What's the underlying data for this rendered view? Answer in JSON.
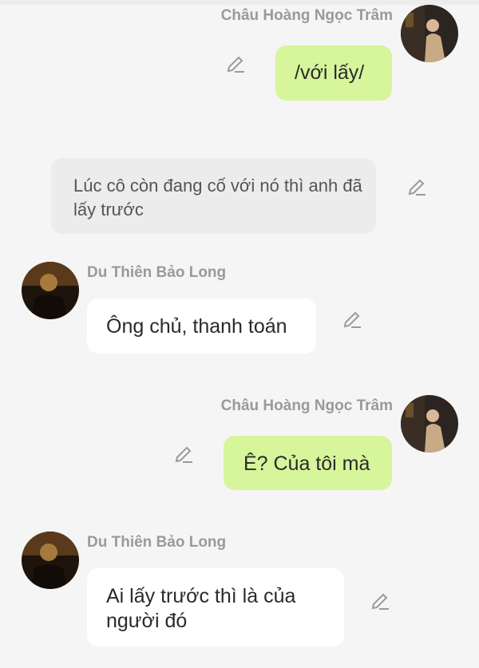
{
  "messages": [
    {
      "sender": "Châu Hoàng Ngọc Trâm",
      "text": "/với lấy/",
      "side": "right",
      "style": "green"
    },
    {
      "text": "Lúc cô còn đang cố với nó thì anh đã lấy trước",
      "style": "narration"
    },
    {
      "sender": "Du Thiên Bảo Long",
      "text": "Ông chủ, thanh toán",
      "side": "left",
      "style": "white"
    },
    {
      "sender": "Châu Hoàng Ngọc Trâm",
      "text": "Ê? Của tôi mà",
      "side": "right",
      "style": "green"
    },
    {
      "sender": "Du Thiên Bảo Long",
      "text": "Ai lấy trước thì là của người đó",
      "side": "left",
      "style": "white"
    }
  ],
  "icons": {
    "edit": "pencil-edit-icon",
    "avatar_female": "avatar-cham",
    "avatar_male": "avatar-long"
  },
  "colors": {
    "background": "#f5f5f5",
    "green_bubble": "#d7f59b",
    "white_bubble": "#ffffff",
    "narration_bubble": "#ececec",
    "name_text": "#9a9a9a"
  }
}
